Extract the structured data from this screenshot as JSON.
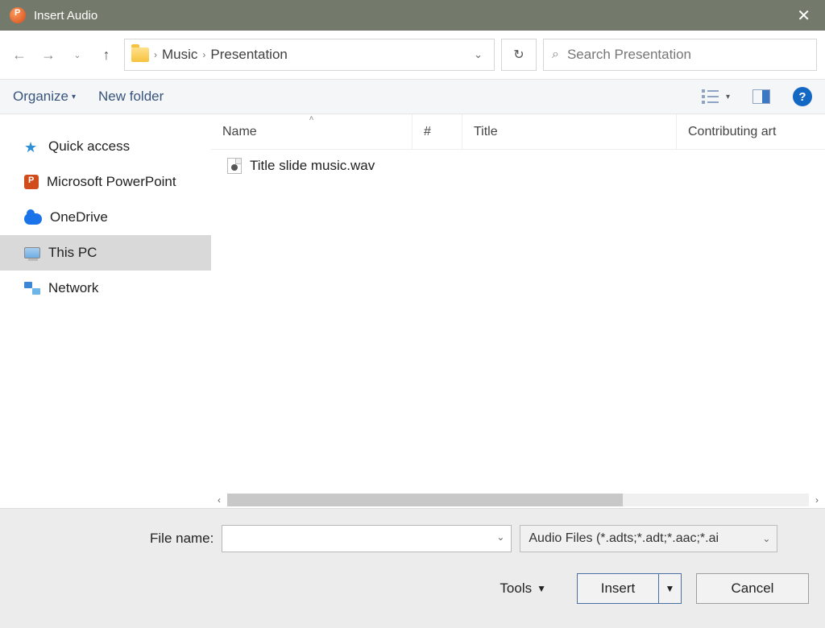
{
  "window": {
    "title": "Insert Audio"
  },
  "breadcrumb": {
    "segments": [
      "Music",
      "Presentation"
    ]
  },
  "search": {
    "placeholder": "Search Presentation"
  },
  "toolbar": {
    "organize": "Organize",
    "new_folder": "New folder"
  },
  "columns": {
    "name": "Name",
    "num": "#",
    "title": "Title",
    "contrib": "Contributing art"
  },
  "files": [
    {
      "name": "Title slide music.wav"
    }
  ],
  "sidebar": [
    {
      "label": "Quick access",
      "icon": "star"
    },
    {
      "label": "Microsoft PowerPoint",
      "icon": "pp"
    },
    {
      "label": "OneDrive",
      "icon": "cloud"
    },
    {
      "label": "This PC",
      "icon": "pc",
      "selected": true
    },
    {
      "label": "Network",
      "icon": "net"
    }
  ],
  "footer": {
    "file_name_label": "File name:",
    "file_name_value": "",
    "type_filter": "Audio Files (*.adts;*.adt;*.aac;*.ai",
    "tools": "Tools",
    "insert": "Insert",
    "cancel": "Cancel"
  }
}
